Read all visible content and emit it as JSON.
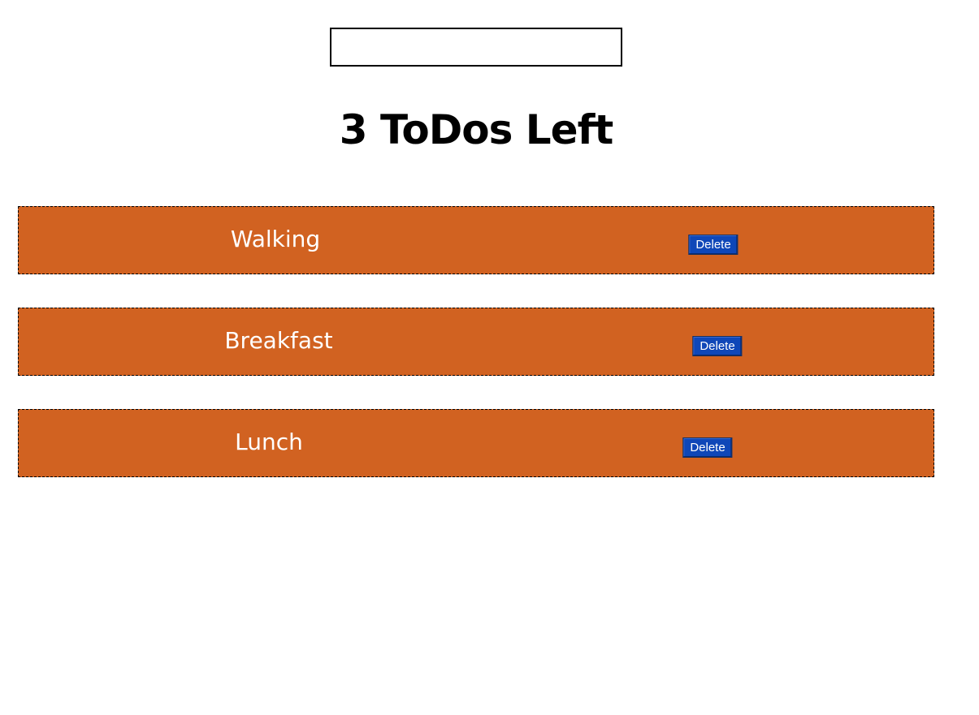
{
  "input": {
    "value": "",
    "placeholder": ""
  },
  "counter": {
    "text": "3 ToDos Left"
  },
  "todos": [
    {
      "label": "Walking",
      "delete_label": "Delete"
    },
    {
      "label": "Breakfast",
      "delete_label": "Delete"
    },
    {
      "label": "Lunch",
      "delete_label": "Delete"
    }
  ],
  "colors": {
    "item_background": "#d16221",
    "button_background": "#0f47b8",
    "item_text": "#ffffff"
  }
}
